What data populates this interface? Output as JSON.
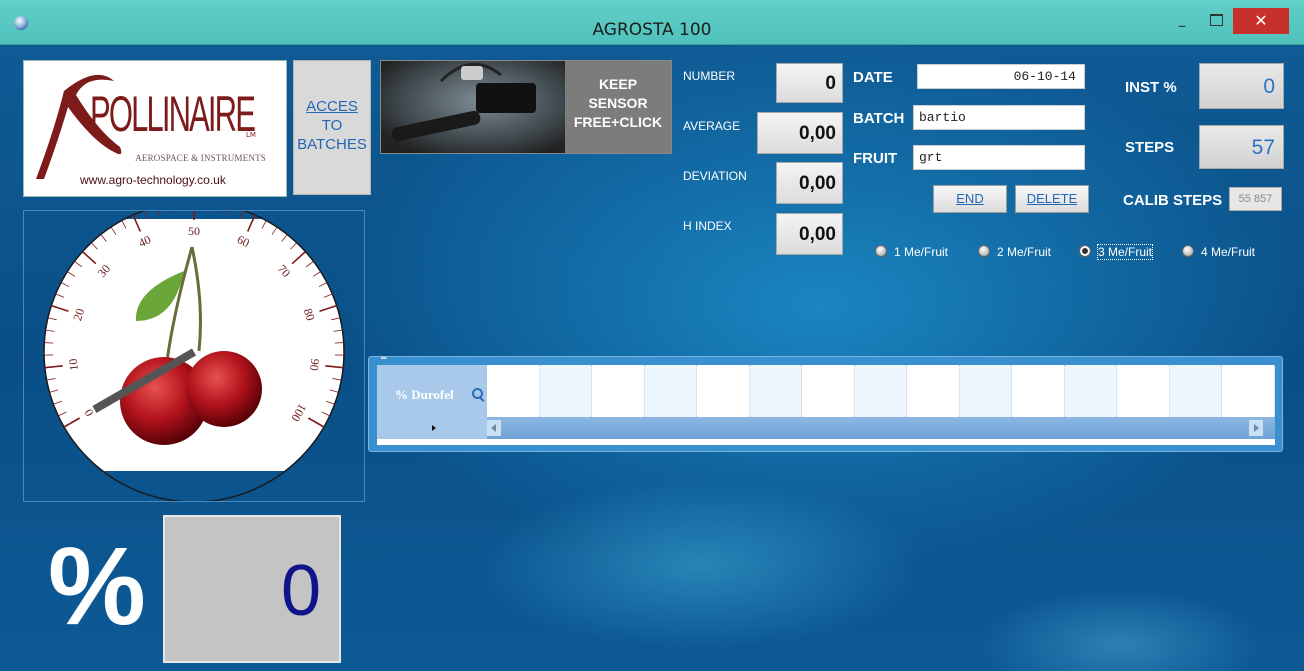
{
  "window": {
    "title": "AGROSTA 100",
    "minimize": "–",
    "close": "✕"
  },
  "logo": {
    "brand": "POLLINAIRE",
    "mark": "LM",
    "tagline": "AEROSPACE & INSTRUMENTS",
    "url": "www.agro-technology.co.uk"
  },
  "acces_button": {
    "line1": "ACCES",
    "line2": "TO",
    "line3": "BATCHES"
  },
  "sensor_button": {
    "line1": "KEEP",
    "line2": "SENSOR",
    "line3": "FREE+CLICK"
  },
  "stats": {
    "number_label": "NUMBER",
    "number_value": "0",
    "average_label": "AVERAGE",
    "average_value": "0,00",
    "deviation_label": "DEVIATION",
    "deviation_value": "0,00",
    "hindex_label": "H INDEX",
    "hindex_value": "0,00"
  },
  "form": {
    "date_label": "DATE",
    "date_value": "06-10-14",
    "batch_label": "BATCH",
    "batch_value": "bartio",
    "fruit_label": "FRUIT",
    "fruit_value": "grt",
    "end_label": "END",
    "delete_label": "DELETE"
  },
  "readings": {
    "inst_label": "INST %",
    "inst_value": "0",
    "steps_label": "STEPS",
    "steps_value": "57",
    "calib_label": "CALIB STEPS",
    "calib_value": "55 857"
  },
  "radios": [
    {
      "label": "1 Me/Fruit",
      "selected": false
    },
    {
      "label": "2 Me/Fruit",
      "selected": false
    },
    {
      "label": "3 Me/Fruit",
      "selected": true
    },
    {
      "label": "4 Me/Fruit",
      "selected": false
    }
  ],
  "grid": {
    "header": "% Durofel"
  },
  "gauge": {
    "ticks": [
      "0",
      "10",
      "20",
      "30",
      "40",
      "50",
      "60",
      "70",
      "80",
      "90",
      "100"
    ],
    "needle_value": 0
  },
  "result": {
    "sign": "%",
    "value": "0"
  },
  "colors": {
    "titlebar": "#4fc1bb",
    "close": "#c7302b",
    "accent_blue": "#2467b5",
    "brand": "#7d1a1a"
  }
}
